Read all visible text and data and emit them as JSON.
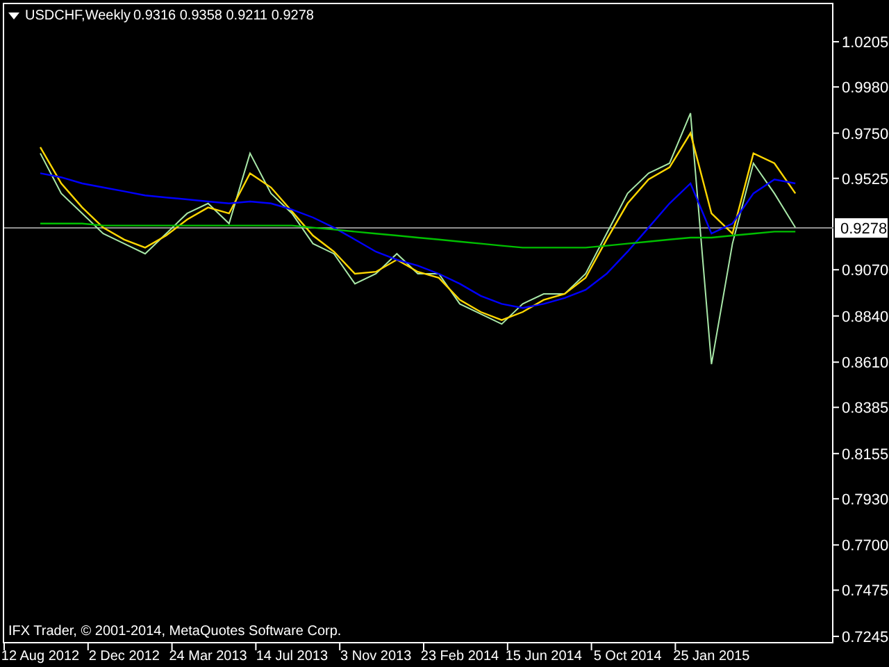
{
  "chart": {
    "symbol": "USDCHF,Weekly",
    "quote": "0.9316 0.9358 0.9211 0.9278",
    "copyright": "IFX Trader, © 2001-2014, MetaQuotes Software Corp.",
    "current_price": "0.9278",
    "chart_data": {
      "type": "line",
      "categories": [
        "12 Aug 2012",
        null,
        null,
        null,
        "2 Dec 2012",
        null,
        null,
        null,
        "24 Mar 2013",
        null,
        null,
        null,
        "14 Jul 2013",
        null,
        null,
        null,
        "3 Nov 2013",
        null,
        null,
        null,
        "23 Feb 2014",
        null,
        null,
        null,
        "15 Jun 2014",
        null,
        null,
        null,
        "5 Oct 2014",
        null,
        null,
        null,
        "25 Jan 2015",
        null,
        null,
        null,
        null
      ],
      "series": [
        {
          "color": "#a8e8a8",
          "values": [
            0.965,
            0.945,
            0.935,
            0.925,
            0.92,
            0.915,
            0.925,
            0.935,
            0.94,
            0.93,
            0.965,
            0.945,
            0.935,
            0.92,
            0.915,
            0.9,
            0.905,
            0.915,
            0.905,
            0.905,
            0.89,
            0.885,
            0.88,
            0.89,
            0.895,
            0.895,
            0.905,
            0.925,
            0.945,
            0.955,
            0.96,
            0.985,
            0.86,
            0.92,
            0.96,
            0.945,
            0.928
          ]
        },
        {
          "color": "#ffd700",
          "values": [
            0.968,
            0.95,
            0.938,
            0.928,
            0.922,
            0.918,
            0.924,
            0.932,
            0.938,
            0.935,
            0.955,
            0.948,
            0.936,
            0.924,
            0.916,
            0.905,
            0.906,
            0.912,
            0.906,
            0.903,
            0.892,
            0.886,
            0.882,
            0.886,
            0.892,
            0.895,
            0.903,
            0.922,
            0.94,
            0.952,
            0.958,
            0.975,
            0.935,
            0.925,
            0.965,
            0.96,
            0.945
          ]
        },
        {
          "color": "#0000ff",
          "values": [
            0.955,
            0.953,
            0.95,
            0.948,
            0.946,
            0.944,
            0.943,
            0.942,
            0.941,
            0.94,
            0.941,
            0.94,
            0.937,
            0.933,
            0.928,
            0.922,
            0.916,
            0.912,
            0.909,
            0.905,
            0.9,
            0.894,
            0.89,
            0.888,
            0.89,
            0.893,
            0.897,
            0.905,
            0.916,
            0.928,
            0.94,
            0.95,
            0.925,
            0.93,
            0.945,
            0.952,
            0.95
          ]
        },
        {
          "color": "#00c000",
          "values": [
            0.93,
            0.93,
            0.93,
            0.929,
            0.929,
            0.929,
            0.929,
            0.929,
            0.929,
            0.929,
            0.929,
            0.929,
            0.929,
            0.928,
            0.927,
            0.926,
            0.925,
            0.924,
            0.923,
            0.922,
            0.921,
            0.92,
            0.919,
            0.918,
            0.918,
            0.918,
            0.918,
            0.919,
            0.92,
            0.921,
            0.922,
            0.923,
            0.923,
            0.924,
            0.925,
            0.926,
            0.926
          ]
        }
      ],
      "ylim": [
        0.7217,
        1.0399
      ],
      "ref_lines": [
        {
          "axis": "y",
          "value": 0.9278,
          "color": "#909090"
        }
      ],
      "yticks": [
        {
          "value": 1.0205,
          "label": "1.0205"
        },
        {
          "value": 0.998,
          "label": "0.9980"
        },
        {
          "value": 0.975,
          "label": "0.9750"
        },
        {
          "value": 0.9525,
          "label": "0.9525"
        },
        {
          "value": 0.907,
          "label": "0.9070"
        },
        {
          "value": 0.884,
          "label": "0.8840"
        },
        {
          "value": 0.861,
          "label": "0.8610"
        },
        {
          "value": 0.8385,
          "label": "0.8385"
        },
        {
          "value": 0.8155,
          "label": "0.8155"
        },
        {
          "value": 0.793,
          "label": "0.7930"
        },
        {
          "value": 0.77,
          "label": "0.7700"
        },
        {
          "value": 0.7475,
          "label": "0.7475"
        },
        {
          "value": 0.7245,
          "label": "0.7245"
        }
      ]
    }
  }
}
